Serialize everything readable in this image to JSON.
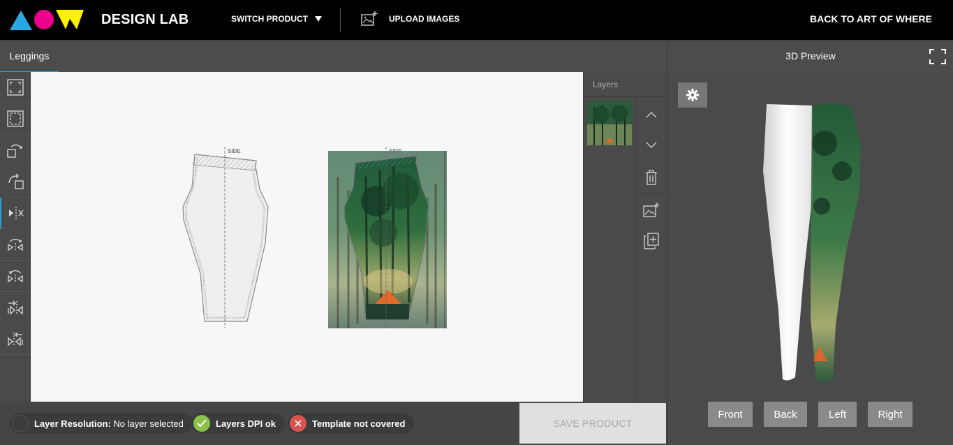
{
  "header": {
    "brand": "DESIGN LAB",
    "switch_product": "SWITCH PRODUCT",
    "upload_images": "UPLOAD IMAGES",
    "back_link": "BACK TO ART OF WHERE"
  },
  "tabs": [
    {
      "label": "Leggings",
      "active": true
    }
  ],
  "preview": {
    "title": "3D Preview",
    "views": [
      "Front",
      "Back",
      "Left",
      "Right"
    ]
  },
  "layers": {
    "title": "Layers"
  },
  "canvas": {
    "template_label_left": "SIDE",
    "template_label_right": "SIDE"
  },
  "toolbar": {
    "tools": [
      "fit-width-icon",
      "fit-height-icon",
      "rotate-left-icon",
      "rotate-right-icon",
      "flip-horizontal-icon",
      "flip-rotate-left-icon",
      "flip-rotate-right-icon",
      "align-right-icon",
      "align-left-icon"
    ]
  },
  "status": {
    "resolution_label": "Layer Resolution:",
    "resolution_value": "No layer selected",
    "dpi": "Layers DPI ok",
    "coverage": "Template not covered"
  },
  "actions": {
    "save": "SAVE PRODUCT"
  },
  "colors": {
    "accent": "#2d9bd6",
    "ok": "#8bc34a",
    "error": "#d9534f",
    "logo_cyan": "#29a9e1",
    "logo_magenta": "#ec008c",
    "logo_yellow": "#fff200"
  }
}
